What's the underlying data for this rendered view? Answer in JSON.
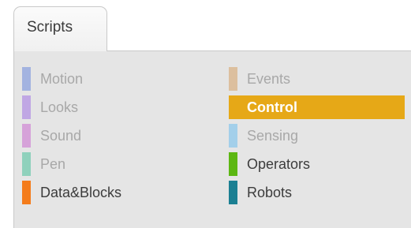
{
  "tab": {
    "label": "Scripts"
  },
  "palette": {
    "left": [
      {
        "label": "Motion",
        "color": "#a3b3e0",
        "state": "dim"
      },
      {
        "label": "Looks",
        "color": "#c0a7e4",
        "state": "dim"
      },
      {
        "label": "Sound",
        "color": "#d6a2d9",
        "state": "dim"
      },
      {
        "label": "Pen",
        "color": "#8fd1bc",
        "state": "dim"
      },
      {
        "label": "Data&Blocks",
        "color": "#f47c1b",
        "state": "normal"
      }
    ],
    "right": [
      {
        "label": "Events",
        "color": "#dcbf9e",
        "state": "dim"
      },
      {
        "label": "Control",
        "color": "#e6a817",
        "state": "selected"
      },
      {
        "label": "Sensing",
        "color": "#a3cfea",
        "state": "dim"
      },
      {
        "label": "Operators",
        "color": "#5cb712",
        "state": "normal"
      },
      {
        "label": "Robots",
        "color": "#1b7f92",
        "state": "normal"
      }
    ]
  },
  "colors": {
    "selected_bg": "#e6a817",
    "panel_bg": "#e5e5e5"
  }
}
